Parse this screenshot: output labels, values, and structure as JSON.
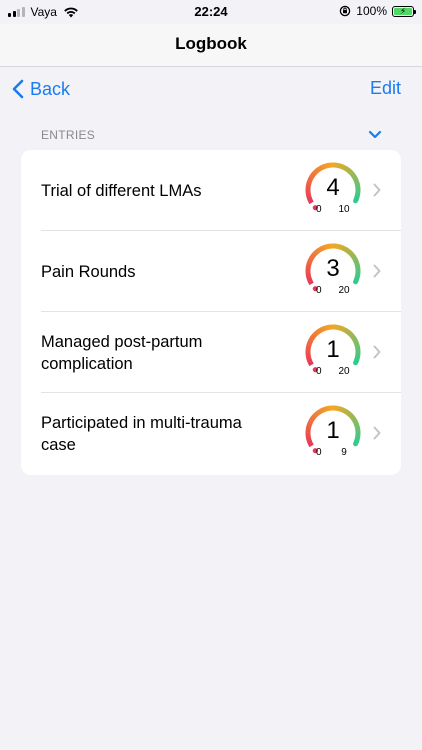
{
  "status_bar": {
    "carrier": "Vaya",
    "time": "22:24",
    "battery_percent": "100%",
    "battery_level": 1.0,
    "signal_bars": 4,
    "signal_bars_active": 2
  },
  "navigation": {
    "title": "Logbook",
    "back_label": "Back",
    "edit_label": "Edit",
    "accent_color": "#1a7cf0"
  },
  "section": {
    "header": "ENTRIES"
  },
  "gauge_colors": {
    "low": "#e8365a",
    "mid": "#f5a623",
    "high": "#2ecc8f"
  },
  "entries": [
    {
      "title": "Trial of different LMAs",
      "value": "4",
      "min": "0",
      "max": "10"
    },
    {
      "title": "Pain Rounds",
      "value": "3",
      "min": "0",
      "max": "20"
    },
    {
      "title": "Managed post-partum complication",
      "value": "1",
      "min": "0",
      "max": "20"
    },
    {
      "title": "Participated in multi-trauma case",
      "value": "1",
      "min": "0",
      "max": "9"
    }
  ]
}
